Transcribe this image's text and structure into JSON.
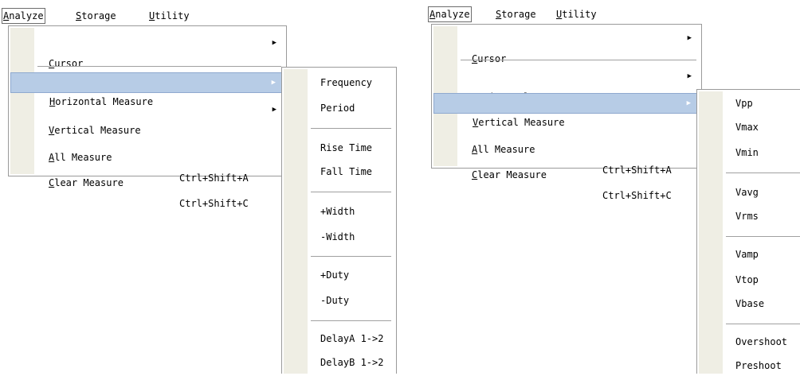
{
  "menubar": {
    "analyze": "Analyze",
    "storage": "Storage",
    "utility": "Utility"
  },
  "analyze_menu": {
    "cursor": "Cursor",
    "horizontal_measure": "Horizontal Measure",
    "vertical_measure": "Vertical Measure",
    "all_measure": "All Measure",
    "all_measure_shortcut": "Ctrl+Shift+A",
    "clear_measure": "Clear Measure",
    "clear_measure_shortcut": "Ctrl+Shift+C"
  },
  "horizontal_submenu": [
    "Frequency",
    "Period",
    "Rise Time",
    "Fall Time",
    "+Width",
    "-Width",
    "+Duty",
    "-Duty",
    "DelayA 1->2",
    "DelayB 1->2"
  ],
  "vertical_submenu": [
    "Vpp",
    "Vmax",
    "Vmin",
    "Vavg",
    "Vrms",
    "Vamp",
    "Vtop",
    "Vbase",
    "Overshoot",
    "Preshoot"
  ],
  "icons": {
    "submenu_arrow": "▶"
  },
  "colors": {
    "highlight": "#b7cce6",
    "stripe": "#efeee4"
  }
}
